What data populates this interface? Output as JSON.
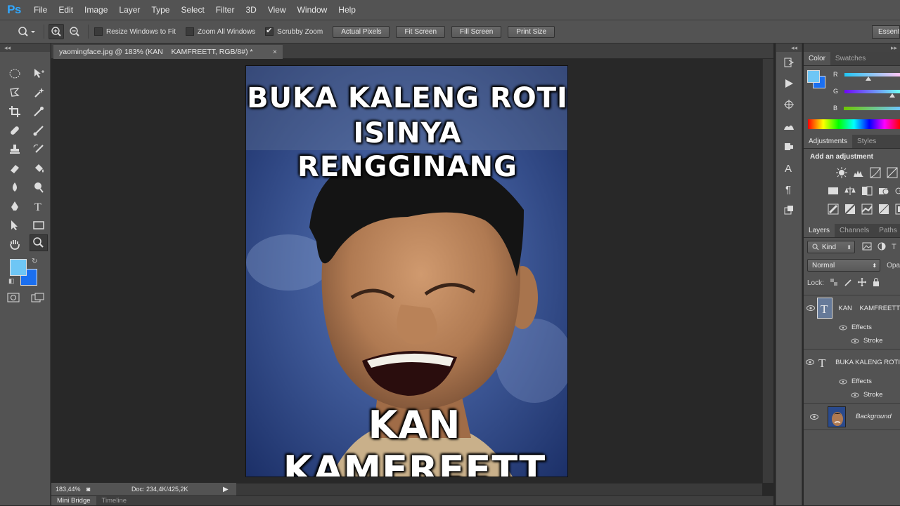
{
  "app": {
    "logo": "Ps"
  },
  "menu": [
    "File",
    "Edit",
    "Image",
    "Layer",
    "Type",
    "Select",
    "Filter",
    "3D",
    "View",
    "Window",
    "Help"
  ],
  "options": {
    "resize_windows": "Resize Windows to Fit",
    "zoom_all": "Zoom All Windows",
    "scrubby": "Scrubby Zoom",
    "buttons": [
      "Actual Pixels",
      "Fit Screen",
      "Fill Screen",
      "Print Size"
    ],
    "workspace": "Essentials"
  },
  "document": {
    "tab_title": "yaomingface.jpg @ 183% (KAN    KAMFREETT, RGB/8#) *",
    "top_text_line1": "BUKA KALENG ROTI",
    "top_text_line2": "ISINYA RENGGINANG",
    "bottom_text": "KAN KAMFREETT"
  },
  "status": {
    "zoom": "183,44%",
    "doc": "Doc: 234,4K/425,2K"
  },
  "bottom_tabs": [
    "Mini Bridge",
    "Timeline"
  ],
  "color_panel": {
    "tabs": [
      "Color",
      "Swatches"
    ],
    "channels": [
      "R",
      "G",
      "B"
    ],
    "fg": "#6ec6f5",
    "bg": "#1b6ff0"
  },
  "adjustments_panel": {
    "tabs": [
      "Adjustments",
      "Styles"
    ],
    "heading": "Add an adjustment"
  },
  "layers_panel": {
    "tabs": [
      "Layers",
      "Channels",
      "Paths"
    ],
    "kind": "Kind",
    "blend_mode": "Normal",
    "opacity_label": "Opa",
    "lock_label": "Lock:",
    "layers": [
      {
        "name": "KAN    KAMFREETT",
        "effects": "Effects",
        "stroke": "Stroke"
      },
      {
        "name": "BUKA KALENG ROTI",
        "effects": "Effects",
        "stroke": "Stroke"
      },
      {
        "name": "Background"
      }
    ]
  }
}
